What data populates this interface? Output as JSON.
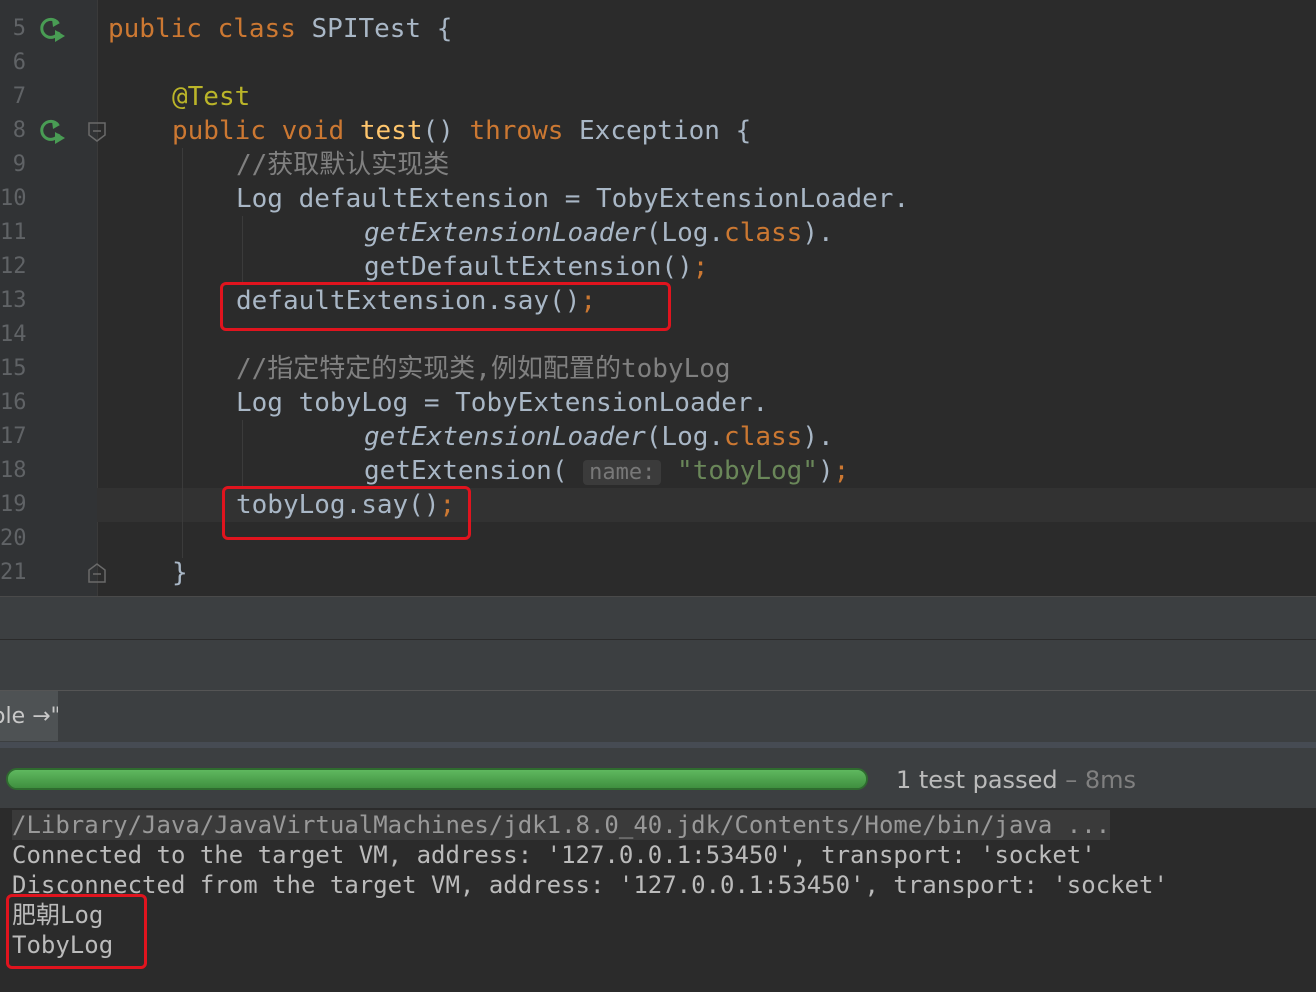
{
  "editor": {
    "line_numbers": [
      "5",
      "6",
      "7",
      "8",
      "9",
      "10",
      "11",
      "12",
      "13",
      "14",
      "15",
      "16",
      "17",
      "18",
      "19",
      "20",
      "21"
    ],
    "code": {
      "l5": {
        "kw1": "public",
        "kw2": "class",
        "name": "SPITest",
        "brace": "{"
      },
      "l7": {
        "annotation": "@Test"
      },
      "l8": {
        "kw1": "public",
        "kw2": "void",
        "method": "test",
        "parens": "()",
        "throws": "throws",
        "exception": "Exception",
        "brace": "{"
      },
      "l9": {
        "comment": "//获取默认实现类"
      },
      "l10": {
        "text": "Log defaultExtension = TobyExtensionLoader."
      },
      "l11": {
        "method": "getExtensionLoader",
        "args_open": "(Log.",
        "kw": "class",
        "args_close": ")."
      },
      "l12": {
        "text": "getDefaultExtension()",
        "semi": ";"
      },
      "l13": {
        "text": "defaultExtension.say()",
        "semi": ";"
      },
      "l15": {
        "comment": "//指定特定的实现类,例如配置的tobyLog"
      },
      "l16": {
        "text": "Log tobyLog = TobyExtensionLoader."
      },
      "l17": {
        "method": "getExtensionLoader",
        "args_open": "(Log.",
        "kw": "class",
        "args_close": ")."
      },
      "l18": {
        "text": "getExtension(",
        "hint": "name:",
        "string": "\"tobyLog\"",
        "close": ")",
        "semi": ";"
      },
      "l19": {
        "text": "tobyLog.say()",
        "semi": ";"
      },
      "l21": {
        "brace": "}"
      }
    }
  },
  "run_tab": {
    "label": "ole →\""
  },
  "test_status": {
    "progress": 1.0,
    "summary": "1 test passed",
    "time": " – 8ms"
  },
  "console": {
    "lines": [
      "/Library/Java/JavaVirtualMachines/jdk1.8.0_40.jdk/Contents/Home/bin/java ...",
      "Connected to the target VM, address: '127.0.0.1:53450', transport: 'socket'",
      "Disconnected from the target VM, address: '127.0.0.1:53450', transport: 'socket'",
      "肥朝Log",
      "TobyLog"
    ]
  },
  "colors": {
    "keyword": "#cc7832",
    "annotation": "#bbb529",
    "method": "#ffc66d",
    "string": "#6a8759",
    "comment": "#808080",
    "highlight_box": "#e0141e",
    "progress": "#499c54"
  },
  "icons": [
    "run-test-icon",
    "fold-marker-icon"
  ]
}
